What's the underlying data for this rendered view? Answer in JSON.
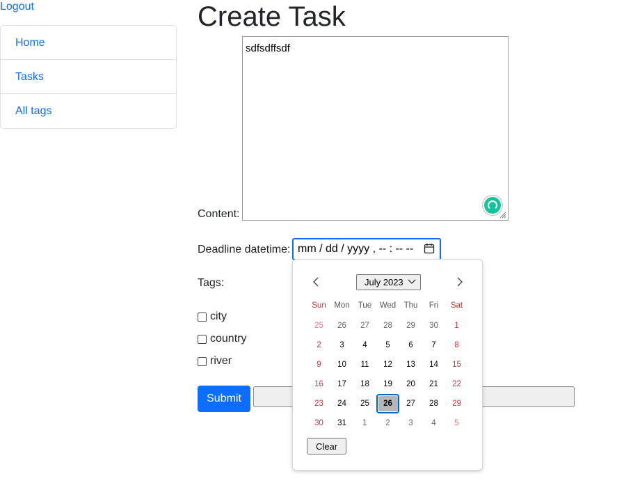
{
  "header": {
    "logout_label": "Logout"
  },
  "sidebar": {
    "items": [
      {
        "label": "Home"
      },
      {
        "label": "Tasks"
      },
      {
        "label": "All tags"
      }
    ]
  },
  "form": {
    "title": "Create Task",
    "content_label": "Content:",
    "content_value": "sdfsdffsdf",
    "deadline_label": "Deadline datetime:",
    "deadline_value": "mm / dd / yyyy ,  -- : --   --",
    "tags_label": "Tags:",
    "tags": [
      {
        "label": "city",
        "checked": false
      },
      {
        "label": "country",
        "checked": false
      },
      {
        "label": "river",
        "checked": false
      }
    ],
    "submit_label": "Submit",
    "grey_bar_text": ""
  },
  "calendar": {
    "month_label": "July 2023",
    "weekdays": [
      "Sun",
      "Mon",
      "Tue",
      "Wed",
      "Thu",
      "Fri",
      "Sat"
    ],
    "days": [
      [
        "25",
        "26",
        "27",
        "28",
        "29",
        "30",
        "1"
      ],
      [
        "2",
        "3",
        "4",
        "5",
        "6",
        "7",
        "8"
      ],
      [
        "9",
        "10",
        "11",
        "12",
        "13",
        "14",
        "15"
      ],
      [
        "16",
        "17",
        "18",
        "19",
        "20",
        "21",
        "22"
      ],
      [
        "23",
        "24",
        "25",
        "26",
        "27",
        "28",
        "29"
      ],
      [
        "30",
        "31",
        "1",
        "2",
        "3",
        "4",
        "5"
      ]
    ],
    "selected_day": "26",
    "clear_label": "Clear"
  },
  "colors": {
    "link": "#0d6efd",
    "weekend": "#d13438",
    "primary_button": "#0d6efd",
    "grammar_icon": "#15c39a"
  }
}
